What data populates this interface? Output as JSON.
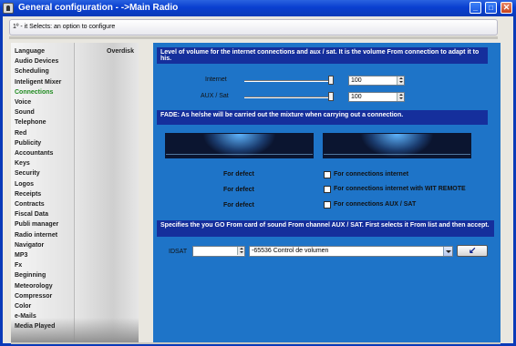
{
  "window": {
    "title": "General configuration - ->Main Radio",
    "minimize": "_",
    "maximize": "□",
    "close": "✕"
  },
  "hint": "1º - it Selects: an option to configure",
  "sidebar": {
    "items": [
      {
        "label": "Language",
        "active": false
      },
      {
        "label": "Audio Devices",
        "active": false
      },
      {
        "label": "Scheduling",
        "active": false
      },
      {
        "label": "Inteligent Mixer",
        "active": false
      },
      {
        "label": "Connections",
        "active": true
      },
      {
        "label": "Voice",
        "active": false
      },
      {
        "label": "Sound",
        "active": false
      },
      {
        "label": "Telephone",
        "active": false
      },
      {
        "label": "Red",
        "active": false
      },
      {
        "label": "Publicity",
        "active": false
      },
      {
        "label": "Accountants",
        "active": false
      },
      {
        "label": "Keys",
        "active": false
      },
      {
        "label": "Security",
        "active": false
      },
      {
        "label": "Logos",
        "active": false
      },
      {
        "label": "Receipts",
        "active": false
      },
      {
        "label": "Contracts",
        "active": false
      },
      {
        "label": "Fiscal Data",
        "active": false
      },
      {
        "label": "Publi manager",
        "active": false
      },
      {
        "label": "Radio internet",
        "active": false
      },
      {
        "label": "Navigator",
        "active": false
      },
      {
        "label": "MP3",
        "active": false
      },
      {
        "label": "Fx",
        "active": false
      },
      {
        "label": "Beginning",
        "active": false
      },
      {
        "label": "Meteorology",
        "active": false
      },
      {
        "label": "Compressor",
        "active": false
      },
      {
        "label": "Color",
        "active": false
      },
      {
        "label": "e-Mails",
        "active": false
      },
      {
        "label": "Media Played",
        "active": false
      }
    ],
    "overdisk": "Overdisk"
  },
  "main": {
    "volume_banner": "Level of volume for the internet connections and aux / sat. It is the volume From connection to adapt it to his.",
    "internet": {
      "label": "Internet",
      "value": "100",
      "level": 1.0
    },
    "aux": {
      "label": "AUX / Sat",
      "value": "100",
      "level": 1.0
    },
    "fade_banner": "FADE: As he/she will be carried out the mixture when carrying out a connection.",
    "defects": [
      {
        "left": "For defect",
        "right": "For connections internet"
      },
      {
        "left": "For defect",
        "right": "For connections internet with WIT REMOTE"
      },
      {
        "left": "For defect",
        "right": "For connections AUX / SAT"
      }
    ],
    "sound_banner": "Specifies the you GO From card of sound From channel AUX / SAT. First selects it From list and then accept.",
    "idsat_label": "IDSAT",
    "idsat_value": "",
    "device_value": "-65536 Control de volumen"
  },
  "colors": {
    "panel": "#1e74c8",
    "banner": "#152f9c",
    "active_item": "#1f8a1f",
    "titlebar": "#0a3fd0"
  }
}
